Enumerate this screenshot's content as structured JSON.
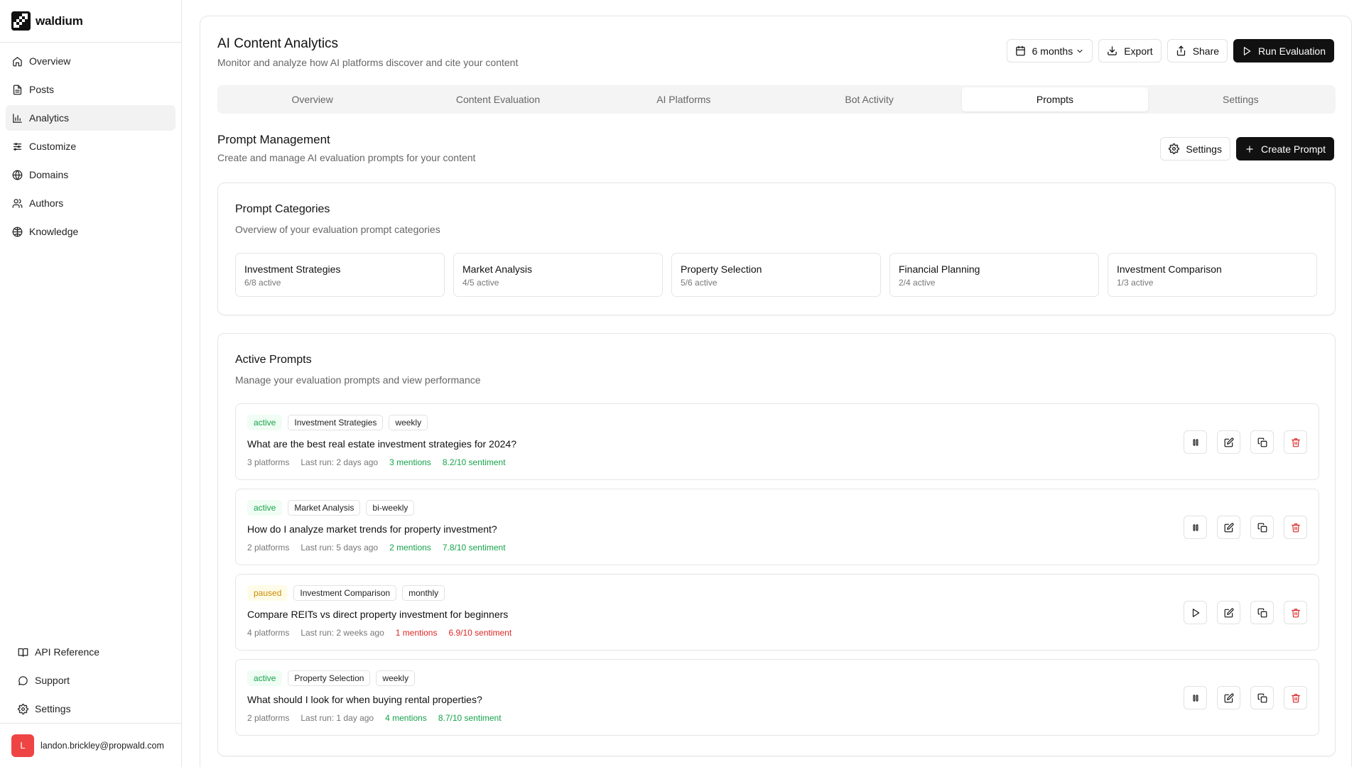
{
  "brand": {
    "name": "waldium"
  },
  "sidebar": {
    "items": [
      {
        "label": "Overview",
        "icon": "home-icon"
      },
      {
        "label": "Posts",
        "icon": "document-icon"
      },
      {
        "label": "Analytics",
        "icon": "bar-chart-icon",
        "active": true
      },
      {
        "label": "Customize",
        "icon": "sliders-icon"
      },
      {
        "label": "Domains",
        "icon": "globe-icon"
      },
      {
        "label": "Authors",
        "icon": "users-icon"
      },
      {
        "label": "Knowledge",
        "icon": "knowledge-globe-icon"
      }
    ],
    "bottom_items": [
      {
        "label": "API Reference",
        "icon": "book-icon"
      },
      {
        "label": "Support",
        "icon": "chat-bubble-icon"
      },
      {
        "label": "Settings",
        "icon": "gear-icon"
      }
    ],
    "user": {
      "initial": "L",
      "email": "landon.brickley@propwald.com",
      "avatar_color": "#ef4444"
    }
  },
  "header": {
    "title": "AI Content Analytics",
    "subtitle": "Monitor and analyze how AI platforms discover and cite your content",
    "range_label": "6 months",
    "export_label": "Export",
    "share_label": "Share",
    "run_label": "Run Evaluation"
  },
  "tabs": [
    {
      "label": "Overview"
    },
    {
      "label": "Content Evaluation"
    },
    {
      "label": "AI Platforms"
    },
    {
      "label": "Bot Activity"
    },
    {
      "label": "Prompts",
      "active": true
    },
    {
      "label": "Settings"
    }
  ],
  "prompt_management": {
    "title": "Prompt Management",
    "subtitle": "Create and manage AI evaluation prompts for your content",
    "settings_label": "Settings",
    "create_label": "Create Prompt"
  },
  "categories": {
    "title": "Prompt Categories",
    "subtitle": "Overview of your evaluation prompt categories",
    "items": [
      {
        "name": "Investment Strategies",
        "count": "6/8 active"
      },
      {
        "name": "Market Analysis",
        "count": "4/5 active"
      },
      {
        "name": "Property Selection",
        "count": "5/6 active"
      },
      {
        "name": "Financial Planning",
        "count": "2/4 active"
      },
      {
        "name": "Investment Comparison",
        "count": "1/3 active"
      }
    ]
  },
  "active_prompts": {
    "title": "Active Prompts",
    "subtitle": "Manage your evaluation prompts and view performance",
    "items": [
      {
        "status": "active",
        "category": "Investment Strategies",
        "frequency": "weekly",
        "question": "What are the best real estate investment strategies for 2024?",
        "platforms": "3 platforms",
        "last_run": "Last run: 2 days ago",
        "mentions": "3 mentions",
        "sentiment": "8.2/10 sentiment",
        "tone": "good",
        "toggle_icon": "pause-icon"
      },
      {
        "status": "active",
        "category": "Market Analysis",
        "frequency": "bi-weekly",
        "question": "How do I analyze market trends for property investment?",
        "platforms": "2 platforms",
        "last_run": "Last run: 5 days ago",
        "mentions": "2 mentions",
        "sentiment": "7.8/10 sentiment",
        "tone": "good",
        "toggle_icon": "pause-icon"
      },
      {
        "status": "paused",
        "category": "Investment Comparison",
        "frequency": "monthly",
        "question": "Compare REITs vs direct property investment for beginners",
        "platforms": "4 platforms",
        "last_run": "Last run: 2 weeks ago",
        "mentions": "1 mentions",
        "sentiment": "6.9/10 sentiment",
        "tone": "bad",
        "toggle_icon": "play-icon"
      },
      {
        "status": "active",
        "category": "Property Selection",
        "frequency": "weekly",
        "question": "What should I look for when buying rental properties?",
        "platforms": "2 platforms",
        "last_run": "Last run: 1 day ago",
        "mentions": "4 mentions",
        "sentiment": "8.7/10 sentiment",
        "tone": "good",
        "toggle_icon": "pause-icon"
      }
    ]
  },
  "colors": {
    "accent_dark": "#111111",
    "success": "#16a34a",
    "danger": "#dc2626",
    "warning": "#ca8a04"
  }
}
